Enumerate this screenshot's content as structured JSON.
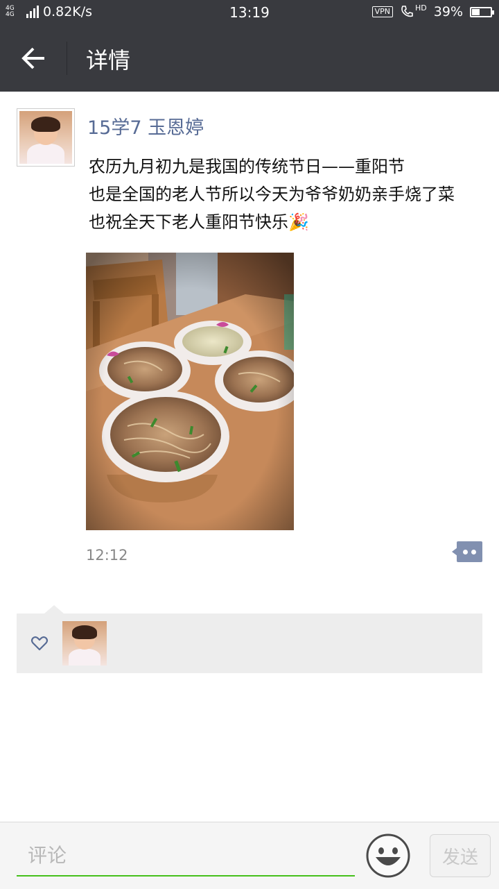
{
  "status_bar": {
    "network": "4G 4G",
    "speed": "0.82K/s",
    "time": "13:19",
    "vpn": "VPN",
    "hd": "HD",
    "battery_percent": "39%",
    "battery_level": 0.39
  },
  "header": {
    "back_icon": "back-arrow-icon",
    "title": "详情"
  },
  "post": {
    "author": "15学7 玉恩婷",
    "text_lines": [
      "农历九月初九是我国的传统节日——重阳节",
      "也是全国的老人节所以今天为爷爷奶奶亲手烧了菜",
      "也祝全天下老人重阳节快乐🎉"
    ],
    "time": "12:12",
    "more_icon": "more-dots-icon"
  },
  "likes": {
    "heart_icon": "heart-icon",
    "count": 1
  },
  "comment_bar": {
    "placeholder": "评论",
    "emoji_icon": "smiley-icon",
    "send_label": "发送"
  },
  "colors": {
    "bar_bg": "#393a3f",
    "name_blue": "#576b95",
    "input_underline": "#45c01a",
    "likes_bg": "#ededed"
  }
}
